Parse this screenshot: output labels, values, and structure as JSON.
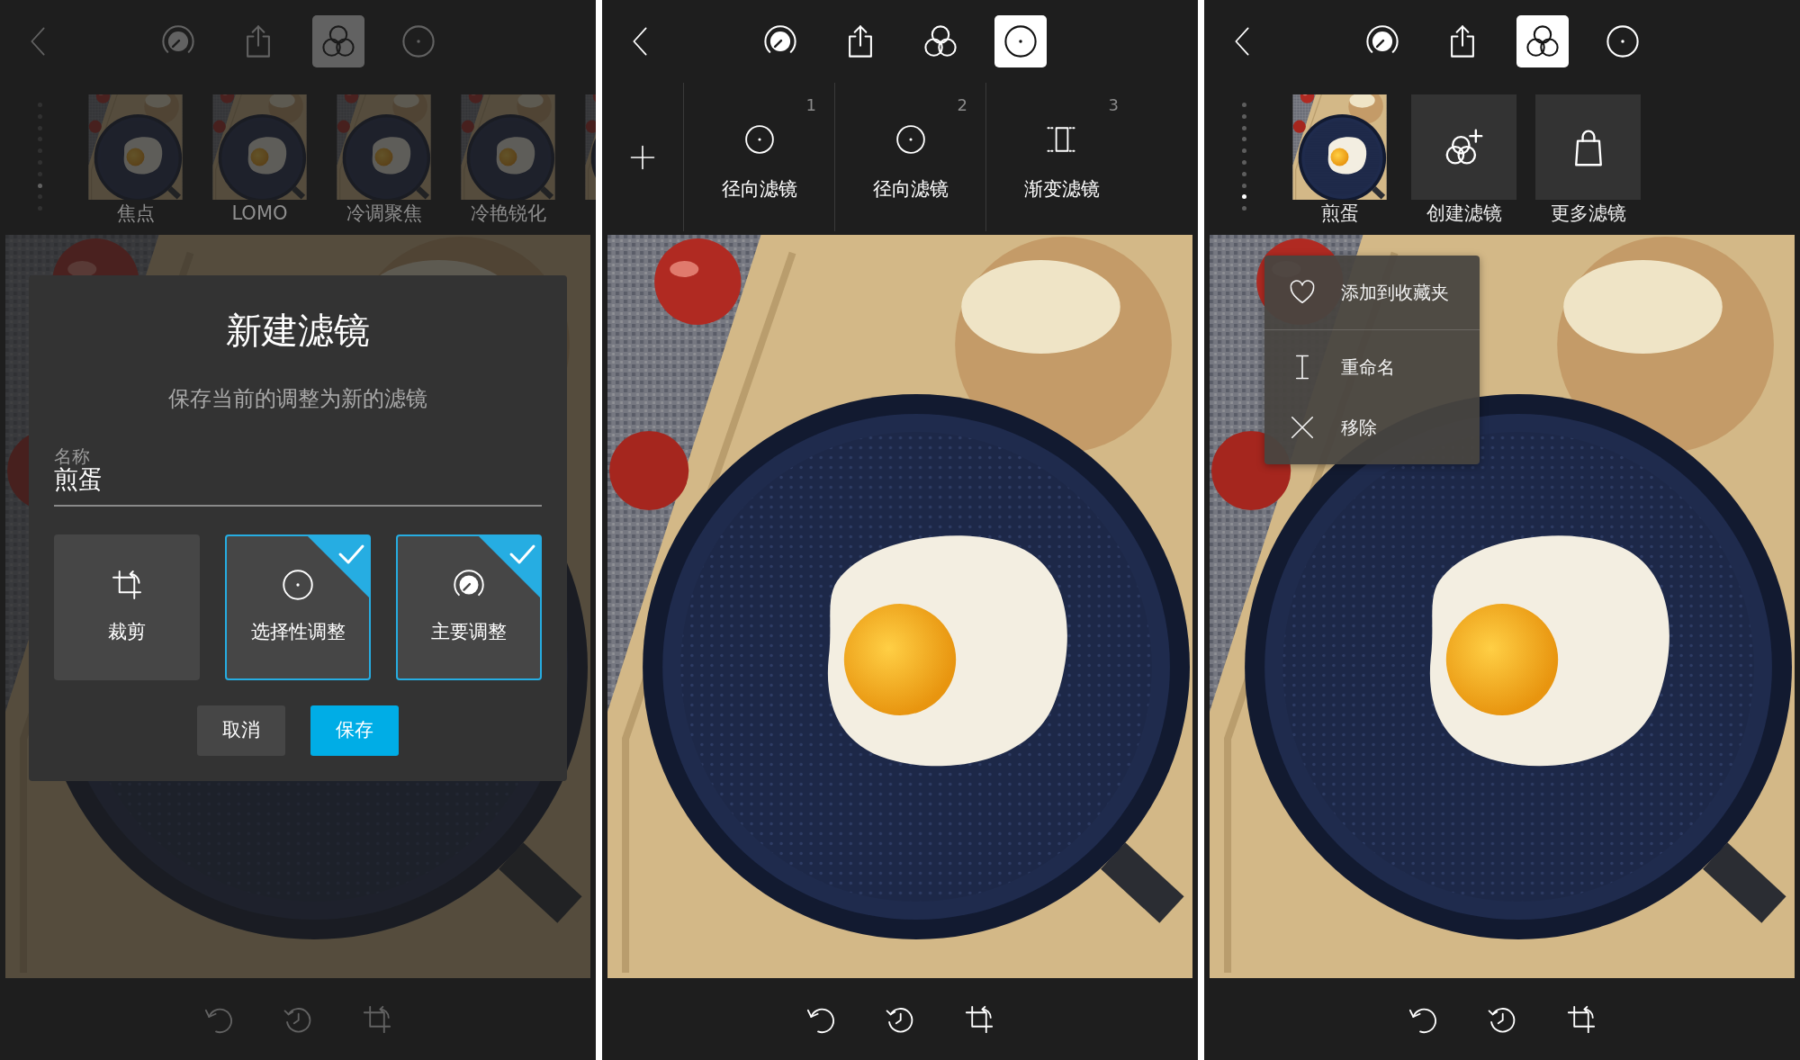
{
  "panels": [
    {
      "toolbar": [
        {
          "kind": "adjust",
          "selected": false
        },
        {
          "kind": "export",
          "selected": false
        },
        {
          "kind": "filters",
          "selected": true
        },
        {
          "kind": "selective",
          "selected": false
        }
      ],
      "strip": {
        "kind": "presets",
        "page_dots": [
          {
            "selected": false
          },
          {
            "selected": false
          },
          {
            "selected": false
          },
          {
            "selected": false
          },
          {
            "selected": false
          },
          {
            "selected": false
          },
          {
            "selected": false
          },
          {
            "selected": true
          },
          {
            "selected": false
          },
          {
            "selected": false
          }
        ],
        "items": [
          {
            "kind": "photo",
            "label": "焦点"
          },
          {
            "kind": "photo",
            "label": "LOMO"
          },
          {
            "kind": "photo",
            "label": "冷调聚焦"
          },
          {
            "kind": "photo",
            "label": "冷艳锐化"
          },
          {
            "kind": "photo"
          }
        ]
      },
      "dialog": {
        "title": "新建滤镜",
        "subtitle": "保存当前的调整为新的滤镜",
        "field": {
          "label": "名称",
          "value": "煎蛋"
        },
        "options": [
          {
            "kind": "crop",
            "label": "裁剪",
            "checked": false
          },
          {
            "kind": "selective",
            "label": "选择性调整",
            "checked": true
          },
          {
            "kind": "adjust",
            "label": "主要调整",
            "checked": true
          }
        ],
        "buttons": [
          {
            "kind": "cancel",
            "label": "取消"
          },
          {
            "kind": "save",
            "label": "保存"
          }
        ]
      }
    },
    {
      "toolbar": [
        {
          "kind": "adjust",
          "selected": false
        },
        {
          "kind": "export",
          "selected": false
        },
        {
          "kind": "filters",
          "selected": false
        },
        {
          "kind": "selective",
          "selected": true
        }
      ],
      "strip": {
        "kind": "layers",
        "items": [
          {
            "kind": "radial",
            "number": "1",
            "label": "径向滤镜"
          },
          {
            "kind": "radial",
            "number": "2",
            "label": "径向滤镜"
          },
          {
            "kind": "graduated",
            "number": "3",
            "label": "渐变滤镜"
          }
        ]
      }
    },
    {
      "toolbar": [
        {
          "kind": "adjust",
          "selected": false
        },
        {
          "kind": "export",
          "selected": false
        },
        {
          "kind": "filters",
          "selected": true
        },
        {
          "kind": "selective",
          "selected": false
        }
      ],
      "strip": {
        "kind": "presets",
        "page_dots": [
          {
            "selected": false
          },
          {
            "selected": false
          },
          {
            "selected": false
          },
          {
            "selected": false
          },
          {
            "selected": false
          },
          {
            "selected": false
          },
          {
            "selected": false
          },
          {
            "selected": false
          },
          {
            "selected": true
          },
          {
            "selected": false
          }
        ],
        "items": [
          {
            "kind": "photo",
            "label": "煎蛋"
          },
          {
            "kind": "create",
            "label": "创建滤镜"
          },
          {
            "kind": "store",
            "label": "更多滤镜"
          }
        ]
      },
      "context_menu": {
        "groups": [
          [
            {
              "kind": "favorite",
              "label": "添加到收藏夹"
            }
          ],
          [
            {
              "kind": "rename",
              "label": "重命名"
            },
            {
              "kind": "remove",
              "label": "移除"
            }
          ]
        ]
      }
    }
  ]
}
